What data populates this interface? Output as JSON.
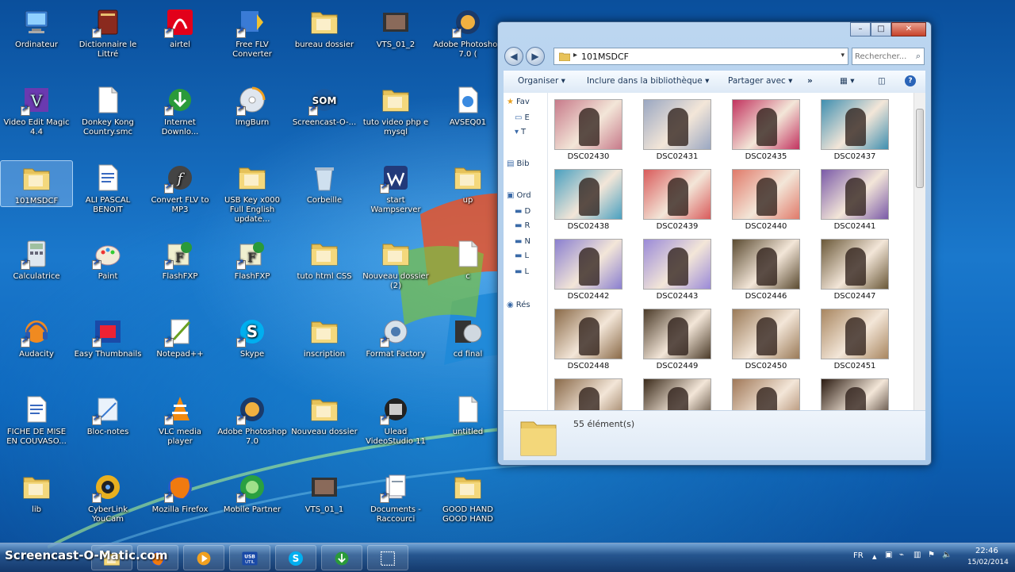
{
  "desktop": {
    "icons": [
      {
        "label": "Ordinateur",
        "icon": "computer-icon"
      },
      {
        "label": "Dictionnaire le Littré",
        "icon": "book-icon"
      },
      {
        "label": "airtel",
        "icon": "airtel-icon"
      },
      {
        "label": "Free FLV Converter",
        "icon": "flv-converter-icon"
      },
      {
        "label": "bureau dossier",
        "icon": "folder-icon"
      },
      {
        "label": "VTS_01_2",
        "icon": "video-file-icon"
      },
      {
        "label": "Adobe Photoshop 7.0 (",
        "icon": "photoshop-icon"
      },
      {
        "label": "Video Edit Magic 4.4",
        "icon": "video-edit-icon"
      },
      {
        "label": "Donkey Kong Country.smc",
        "icon": "file-icon"
      },
      {
        "label": "Internet Downlo...",
        "icon": "download-manager-icon"
      },
      {
        "label": "ImgBurn",
        "icon": "disc-icon"
      },
      {
        "label": "Screencast-O-...",
        "icon": "screencast-icon"
      },
      {
        "label": "tuto video php e mysql",
        "icon": "folder-icon"
      },
      {
        "label": "AVSEQ01",
        "icon": "media-file-icon"
      },
      {
        "label": "101MSDCF",
        "icon": "folder-icon"
      },
      {
        "label": "ALI PASCAL BENOIT",
        "icon": "word-doc-icon"
      },
      {
        "label": "Convert FLV to MP3",
        "icon": "flash-icon"
      },
      {
        "label": "USB Key x000 Full English update...",
        "icon": "folder-icon"
      },
      {
        "label": "Corbeille",
        "icon": "recycle-bin-icon"
      },
      {
        "label": "start Wampserver",
        "icon": "wampserver-icon"
      },
      {
        "label": "up",
        "icon": "folder-icon"
      },
      {
        "label": "Calculatrice",
        "icon": "calculator-icon"
      },
      {
        "label": "Paint",
        "icon": "paint-icon"
      },
      {
        "label": "FlashFXP",
        "icon": "ftp-icon"
      },
      {
        "label": "FlashFXP",
        "icon": "ftp-icon"
      },
      {
        "label": "tuto html CSS",
        "icon": "folder-icon"
      },
      {
        "label": "Nouveau dossier (2)",
        "icon": "folder-icon"
      },
      {
        "label": "c",
        "icon": "file-icon"
      },
      {
        "label": "Audacity",
        "icon": "audacity-icon"
      },
      {
        "label": "Easy Thumbnails",
        "icon": "thumbnails-icon"
      },
      {
        "label": "Notepad++",
        "icon": "notepad-icon"
      },
      {
        "label": "Skype",
        "icon": "skype-icon"
      },
      {
        "label": "inscription",
        "icon": "folder-icon"
      },
      {
        "label": "Format Factory",
        "icon": "format-factory-icon"
      },
      {
        "label": "cd final",
        "icon": "disc-file-icon"
      },
      {
        "label": "FICHE DE MISE EN COUVASO...",
        "icon": "word-doc-icon"
      },
      {
        "label": "Bloc-notes",
        "icon": "notes-icon"
      },
      {
        "label": "VLC media player",
        "icon": "vlc-icon"
      },
      {
        "label": "Adobe Photoshop 7.0",
        "icon": "photoshop-icon"
      },
      {
        "label": "Nouveau dossier",
        "icon": "folder-icon"
      },
      {
        "label": "Ulead VideoStudio 11",
        "icon": "videostudio-icon"
      },
      {
        "label": "untitled",
        "icon": "file-icon"
      },
      {
        "label": "lib",
        "icon": "folder-icon"
      },
      {
        "label": "CyberLink YouCam",
        "icon": "webcam-icon"
      },
      {
        "label": "Mozilla Firefox",
        "icon": "firefox-icon"
      },
      {
        "label": "Mobile Partner",
        "icon": "mobile-partner-icon"
      },
      {
        "label": "VTS_01_1",
        "icon": "video-file-icon"
      },
      {
        "label": "Documents - Raccourci",
        "icon": "documents-icon"
      },
      {
        "label": "GOOD HAND GOOD HAND",
        "icon": "folder-icon"
      }
    ]
  },
  "window": {
    "controls": {
      "minimize": "–",
      "maximize": "□",
      "close": "✕"
    },
    "address": {
      "path": "101MSDCF",
      "separator": "▸"
    },
    "search": {
      "placeholder": "Rechercher..."
    },
    "toolbar": {
      "organize": "Organiser",
      "include": "Inclure dans la bibliothèque",
      "share": "Partager avec",
      "more": "»"
    },
    "navpane": [
      {
        "label": "Fav",
        "icon": "star-icon"
      },
      {
        "label": "E",
        "icon": "desktop-icon"
      },
      {
        "label": "T",
        "icon": "downloads-icon"
      },
      {
        "label": "Bib",
        "icon": "library-icon"
      },
      {
        "label": "Ord",
        "icon": "computer-icon"
      },
      {
        "label": "D",
        "icon": "drive-icon"
      },
      {
        "label": "R",
        "icon": "drive-icon"
      },
      {
        "label": "N",
        "icon": "drive-icon"
      },
      {
        "label": "L",
        "icon": "drive-icon"
      },
      {
        "label": "L",
        "icon": "drive-icon"
      },
      {
        "label": "Rés",
        "icon": "network-icon"
      }
    ],
    "files": [
      {
        "name": "DSC02430",
        "tone": "#c77a8a"
      },
      {
        "name": "DSC02431",
        "tone": "#9aa7c2"
      },
      {
        "name": "DSC02435",
        "tone": "#c2335f"
      },
      {
        "name": "DSC02437",
        "tone": "#3f8fb0"
      },
      {
        "name": "DSC02438",
        "tone": "#4aa0c0"
      },
      {
        "name": "DSC02439",
        "tone": "#d95b5b"
      },
      {
        "name": "DSC02440",
        "tone": "#e07a6a"
      },
      {
        "name": "DSC02441",
        "tone": "#7a5aa8"
      },
      {
        "name": "DSC02442",
        "tone": "#8a7fd0"
      },
      {
        "name": "DSC02443",
        "tone": "#9a8ad8"
      },
      {
        "name": "DSC02446",
        "tone": "#5a4a30"
      },
      {
        "name": "DSC02447",
        "tone": "#6a5838"
      },
      {
        "name": "DSC02448",
        "tone": "#8a6a48"
      },
      {
        "name": "DSC02449",
        "tone": "#4a3a28"
      },
      {
        "name": "DSC02450",
        "tone": "#9a7a58"
      },
      {
        "name": "DSC02451",
        "tone": "#a88660"
      },
      {
        "name": "",
        "tone": "#8a6a4a"
      },
      {
        "name": "",
        "tone": "#3a2a1a"
      },
      {
        "name": "",
        "tone": "#a07858"
      },
      {
        "name": "",
        "tone": "#2a1a10"
      }
    ],
    "details": {
      "count": "55 élément(s)"
    }
  },
  "taskbar": {
    "watermark": "Screencast-O-Matic.com",
    "apps": [
      {
        "icon": "folder-icon"
      },
      {
        "icon": "firefox-icon"
      },
      {
        "icon": "media-player-icon"
      },
      {
        "icon": "usb-util-icon"
      },
      {
        "icon": "skype-icon"
      },
      {
        "icon": "download-manager-icon"
      },
      {
        "icon": "screen-capture-icon"
      }
    ],
    "usb_label": "USB\nUTIL",
    "tray": {
      "lang": "FR",
      "time": "22:46",
      "date": "15/02/2014"
    }
  }
}
